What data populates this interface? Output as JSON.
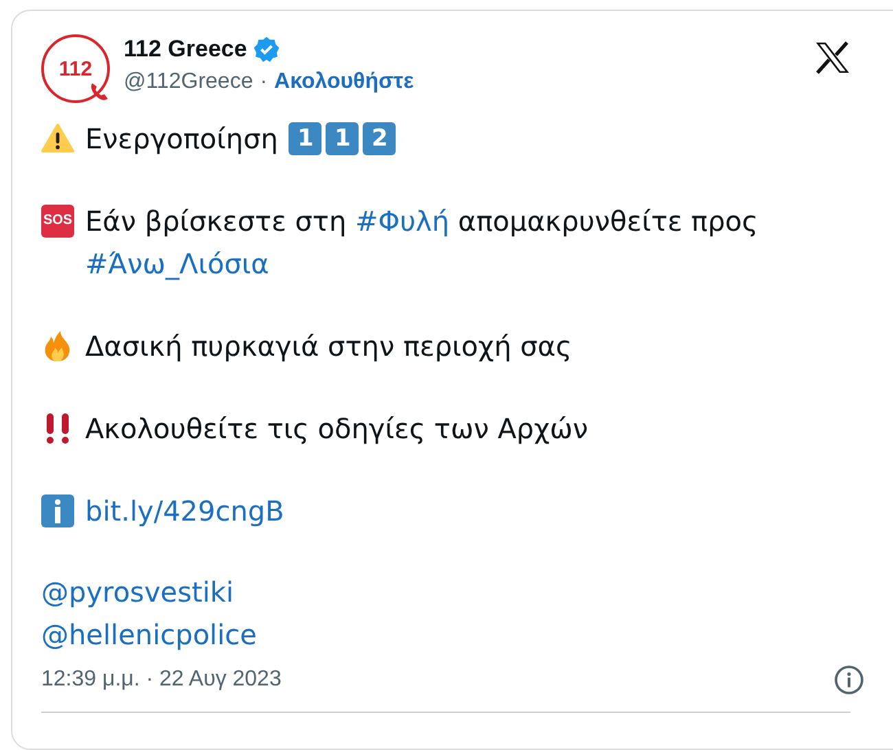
{
  "author": {
    "name": "112 Greece",
    "verified": true,
    "handle": "@112Greece",
    "separator": "·",
    "follow": "Ακολουθήστε",
    "avatar_text": "112"
  },
  "paragraphs": [
    {
      "kind": "warning",
      "parts": [
        {
          "kind": "text",
          "text": "Ενεργοποίηση"
        }
      ],
      "keycaps": [
        "1",
        "1",
        "2"
      ]
    },
    {
      "kind": "sos",
      "badge": "SOS",
      "parts": [
        {
          "kind": "text",
          "text": "Εάν βρίσκεστε στη "
        },
        {
          "kind": "link",
          "text": "#Φυλή"
        },
        {
          "kind": "text",
          "text": " απομακρυνθείτε προς "
        },
        {
          "kind": "link",
          "text": "#Άνω_Λιόσια"
        }
      ]
    },
    {
      "kind": "fire",
      "parts": [
        {
          "kind": "text",
          "text": "Δασική πυρκαγιά στην περιοχή σας"
        }
      ]
    },
    {
      "kind": "double-exclamation",
      "parts": [
        {
          "kind": "text",
          "text": "Ακολουθείτε τις οδηγίες των Αρχών"
        }
      ]
    },
    {
      "kind": "info",
      "parts": [
        {
          "kind": "link",
          "text": "bit.ly/429cngB"
        }
      ]
    }
  ],
  "mentions": [
    "@pyrosvestiki",
    "@hellenicpolice"
  ],
  "timestamp": "12:39 μ.μ. · 22 Αυγ 2023"
}
